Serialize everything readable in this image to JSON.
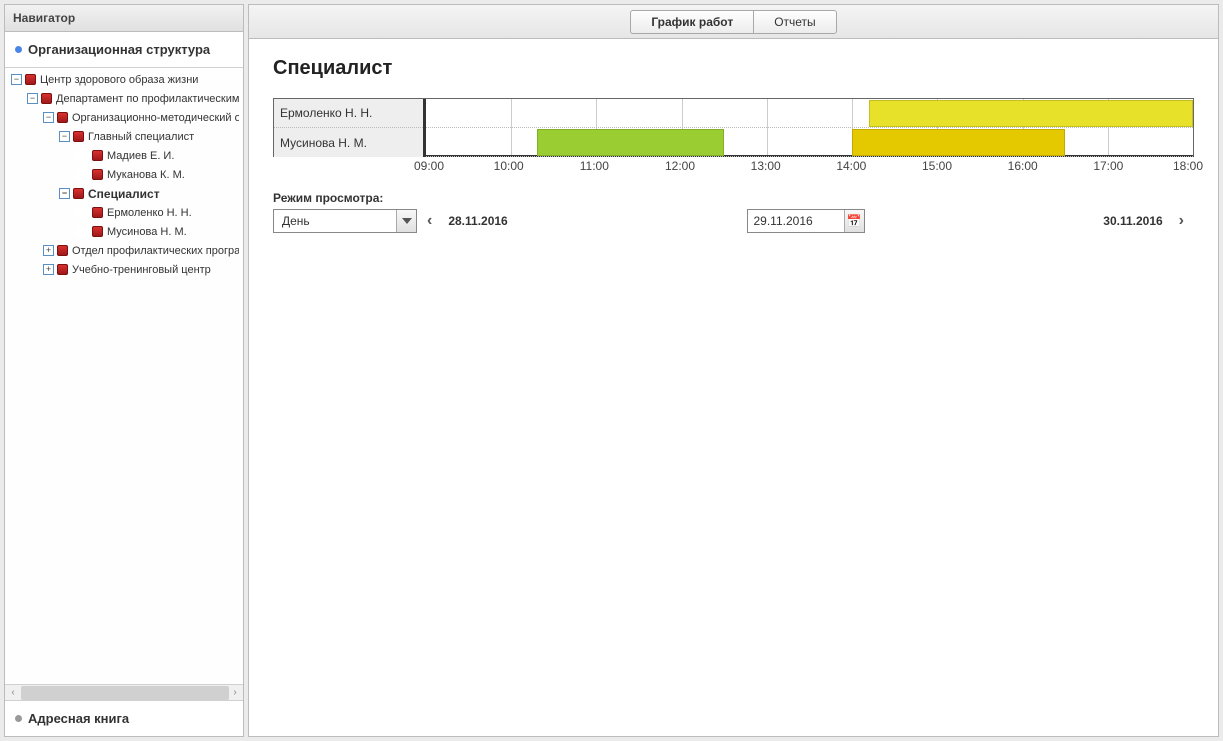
{
  "navigator": {
    "title": "Навигатор",
    "sections": {
      "org": "Организационная структура",
      "addr": "Адресная книга"
    },
    "tree": [
      {
        "level": 0,
        "toggle": "−",
        "label": "Центр здорового образа жизни",
        "selected": false
      },
      {
        "level": 1,
        "toggle": "−",
        "label": "Департамент по профилактическим п",
        "selected": false
      },
      {
        "level": 2,
        "toggle": "−",
        "label": "Организационно-методический от",
        "selected": false
      },
      {
        "level": 3,
        "toggle": "−",
        "label": "Главный специалист",
        "selected": false
      },
      {
        "level": 4,
        "toggle": "",
        "label": "Мадиев Е. И.",
        "selected": false
      },
      {
        "level": 4,
        "toggle": "",
        "label": "Муканова К. М.",
        "selected": false
      },
      {
        "level": 3,
        "toggle": "−",
        "label": "Специалист",
        "selected": true
      },
      {
        "level": 4,
        "toggle": "",
        "label": "Ермоленко Н. Н.",
        "selected": false
      },
      {
        "level": 4,
        "toggle": "",
        "label": "Мусинова Н. М.",
        "selected": false
      },
      {
        "level": 2,
        "toggle": "+",
        "label": "Отдел профилактических програм",
        "selected": false
      },
      {
        "level": 2,
        "toggle": "+",
        "label": "Учебно-тренинговый центр",
        "selected": false
      }
    ]
  },
  "tabs": {
    "schedule": "График работ",
    "reports": "Отчеты"
  },
  "page_title": "Специалист",
  "chart_data": {
    "type": "bar",
    "orientation": "horizontal-gantt",
    "x_axis": {
      "min_h": 9,
      "max_h": 18,
      "step_h": 1,
      "labels": [
        "09:00",
        "10:00",
        "11:00",
        "12:00",
        "13:00",
        "14:00",
        "15:00",
        "16:00",
        "17:00",
        "18:00"
      ]
    },
    "rows": [
      {
        "name": "Ермоленко Н. Н.",
        "bars": [
          {
            "start_h": 14.2,
            "end_h": 18.0,
            "color": "#e8e12a"
          }
        ]
      },
      {
        "name": "Мусинова Н. М.",
        "bars": [
          {
            "start_h": 10.3,
            "end_h": 12.5,
            "color": "#9acd32"
          },
          {
            "start_h": 14.0,
            "end_h": 16.5,
            "color": "#e4c800"
          }
        ]
      }
    ]
  },
  "controls": {
    "viewmode_label": "Режим просмотра:",
    "viewmode_value": "День",
    "prev_date": "28.11.2016",
    "current_date": "29.11.2016",
    "next_date": "30.11.2016"
  },
  "icons": {
    "calendar": "📅"
  }
}
